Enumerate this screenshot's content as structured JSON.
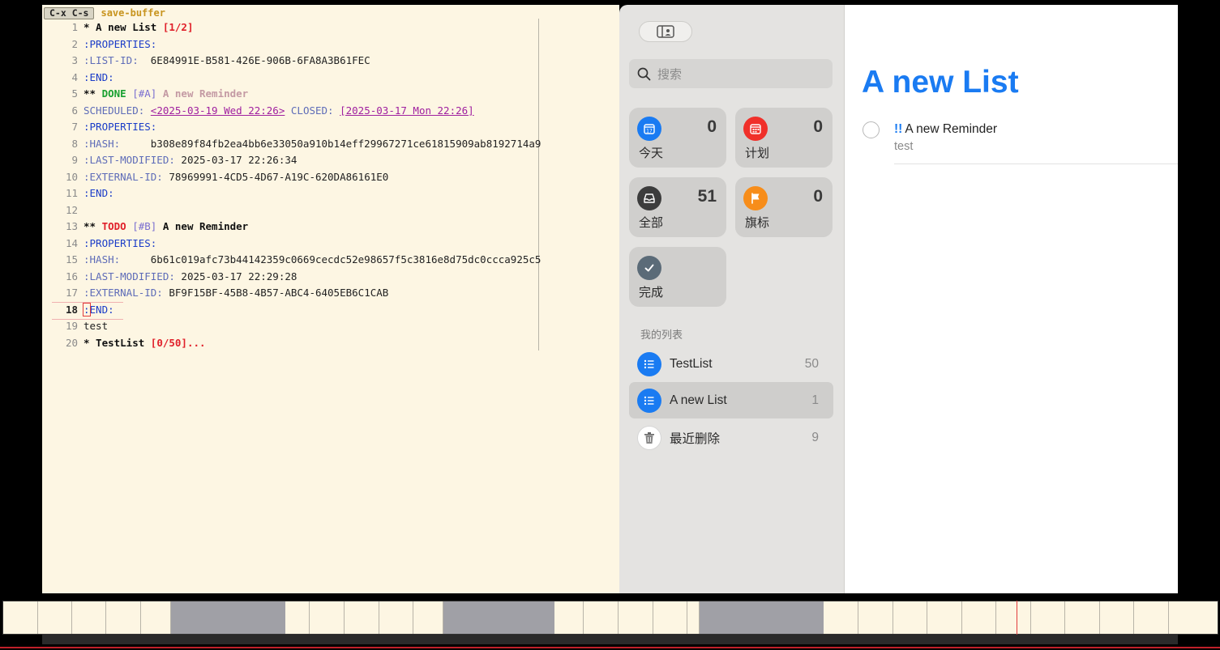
{
  "emacs": {
    "keycast_key": "C-x C-s",
    "keycast_command": "save-buffer",
    "lines": [
      {
        "n": "1",
        "p": [
          {
            "t": "* A new List ",
            "c": "h1"
          },
          {
            "t": "[1/2]",
            "c": "cookie"
          }
        ]
      },
      {
        "n": "2",
        "p": [
          {
            "t": ":PROPERTIES:",
            "c": "kw"
          }
        ]
      },
      {
        "n": "3",
        "p": [
          {
            "t": ":LIST-ID:",
            "c": "kwdim"
          },
          {
            "t": "  6E84991E-B581-426E-906B-6FA8A3B61FEC",
            "c": "val"
          }
        ]
      },
      {
        "n": "4",
        "p": [
          {
            "t": ":END:",
            "c": "kw"
          }
        ]
      },
      {
        "n": "5",
        "p": [
          {
            "t": "** ",
            "c": "stars"
          },
          {
            "t": "DONE",
            "c": "done"
          },
          {
            "t": " ",
            "c": "val"
          },
          {
            "t": "[#A]",
            "c": "pri"
          },
          {
            "t": " A new Reminder",
            "c": "done-title"
          }
        ]
      },
      {
        "n": "6",
        "p": [
          {
            "t": "SCHEDULED: ",
            "c": "kwdim"
          },
          {
            "t": "<2025-03-19 Wed 22:26>",
            "c": "ts"
          },
          {
            "t": " CLOSED: ",
            "c": "kwdim"
          },
          {
            "t": "[2025-03-17 Mon 22:26]",
            "c": "ts"
          }
        ]
      },
      {
        "n": "7",
        "p": [
          {
            "t": ":PROPERTIES:",
            "c": "kw"
          }
        ]
      },
      {
        "n": "8",
        "p": [
          {
            "t": ":HASH:",
            "c": "kwdim"
          },
          {
            "t": "     b308e89f84fb2ea4bb6e33050a910b14eff29967271ce61815909ab8192714a9",
            "c": "val"
          }
        ]
      },
      {
        "n": "9",
        "p": [
          {
            "t": ":LAST-MODIFIED:",
            "c": "kwdim"
          },
          {
            "t": " 2025-03-17 22:26:34",
            "c": "val"
          }
        ]
      },
      {
        "n": "10",
        "p": [
          {
            "t": ":EXTERNAL-ID:",
            "c": "kwdim"
          },
          {
            "t": " 78969991-4CD5-4D67-A19C-620DA86161E0",
            "c": "val"
          }
        ]
      },
      {
        "n": "11",
        "p": [
          {
            "t": ":END:",
            "c": "kw"
          }
        ]
      },
      {
        "n": "12",
        "p": []
      },
      {
        "n": "13",
        "p": [
          {
            "t": "** ",
            "c": "stars"
          },
          {
            "t": "TODO",
            "c": "todo"
          },
          {
            "t": " ",
            "c": "val"
          },
          {
            "t": "[#B]",
            "c": "pri"
          },
          {
            "t": " A new Reminder",
            "c": "h2"
          }
        ]
      },
      {
        "n": "14",
        "p": [
          {
            "t": ":PROPERTIES:",
            "c": "kw"
          }
        ]
      },
      {
        "n": "15",
        "p": [
          {
            "t": ":HASH:",
            "c": "kwdim"
          },
          {
            "t": "     6b61c019afc73b44142359c0669cecdc52e98657f5c3816e8d75dc0ccca925c5",
            "c": "val"
          }
        ]
      },
      {
        "n": "16",
        "p": [
          {
            "t": ":LAST-MODIFIED:",
            "c": "kwdim"
          },
          {
            "t": " 2025-03-17 22:29:28",
            "c": "val"
          }
        ]
      },
      {
        "n": "17",
        "p": [
          {
            "t": ":EXTERNAL-ID:",
            "c": "kwdim"
          },
          {
            "t": " BF9F15BF-45B8-4B57-ABC4-6405EB6C1CAB",
            "c": "val"
          }
        ]
      },
      {
        "n": "18",
        "current": true,
        "p": [
          {
            "t": ":",
            "c": "cursor"
          },
          {
            "t": "END:",
            "c": "kw"
          }
        ]
      },
      {
        "n": "19",
        "p": [
          {
            "t": "test",
            "c": "val"
          }
        ]
      },
      {
        "n": "20",
        "p": [
          {
            "t": "* TestList ",
            "c": "h1"
          },
          {
            "t": "[0/50]...",
            "c": "cookie"
          }
        ]
      }
    ]
  },
  "sidebar": {
    "search_placeholder": "搜索",
    "smart_lists": [
      {
        "id": "today",
        "label": "今天",
        "count": "0",
        "color": "#1a7bf2",
        "icon": "calendar-today-icon"
      },
      {
        "id": "scheduled",
        "label": "计划",
        "count": "0",
        "color": "#f0302a",
        "icon": "calendar-grid-icon"
      },
      {
        "id": "all",
        "label": "全部",
        "count": "51",
        "color": "#3c3c3c",
        "icon": "tray-icon"
      },
      {
        "id": "flagged",
        "label": "旗标",
        "count": "0",
        "color": "#f78d1a",
        "icon": "flag-icon"
      },
      {
        "id": "completed",
        "label": "完成",
        "count": "",
        "color": "#5b6b78",
        "icon": "checkmark-icon"
      }
    ],
    "my_lists_header": "我的列表",
    "lists": [
      {
        "name": "TestList",
        "count": "50",
        "color": "#1a7bf2",
        "icon": "list-bullet-icon"
      },
      {
        "name": "A new List",
        "count": "1",
        "color": "#1a7bf2",
        "icon": "list-bullet-icon",
        "selected": true
      },
      {
        "name": "最近删除",
        "count": "9",
        "color": "#ffffff",
        "icon": "trash-icon"
      }
    ]
  },
  "main": {
    "title": "A new List",
    "title_color": "#1a7bf2",
    "reminder": {
      "priority": "!!",
      "title": "A new Reminder",
      "notes": "test"
    }
  }
}
